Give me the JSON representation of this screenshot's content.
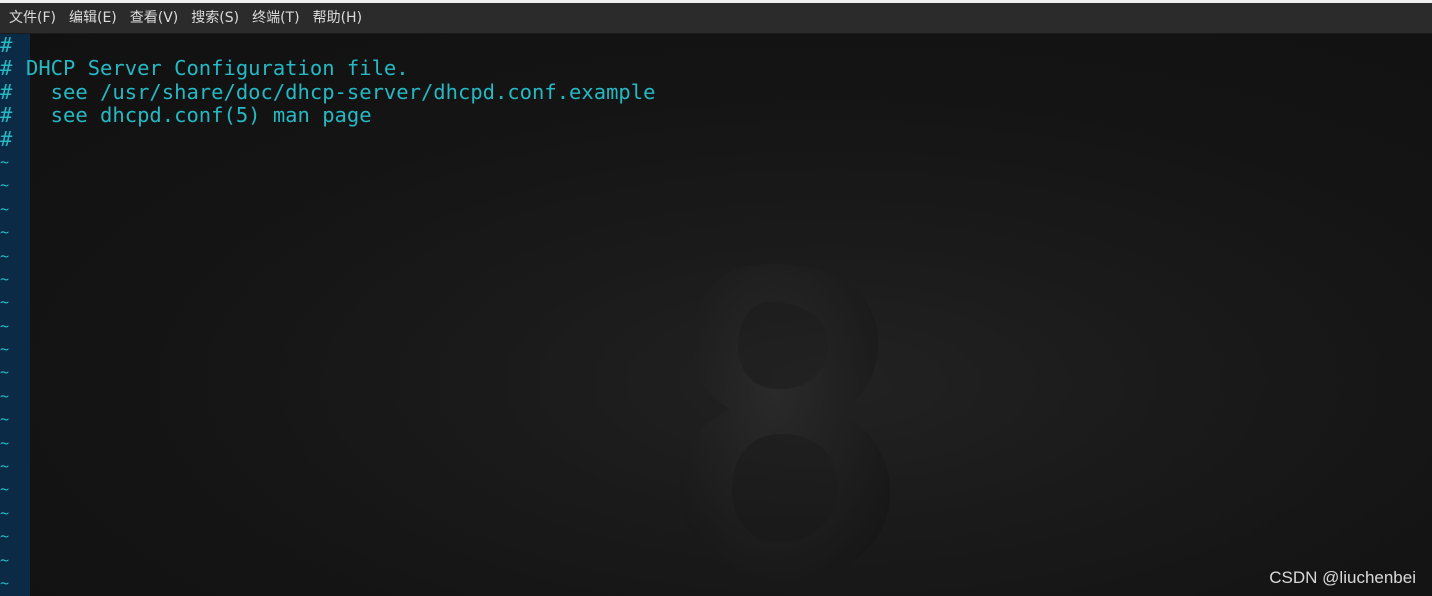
{
  "menu": {
    "items": [
      {
        "label": "文件(F)"
      },
      {
        "label": "编辑(E)"
      },
      {
        "label": "查看(V)"
      },
      {
        "label": "搜索(S)"
      },
      {
        "label": "终端(T)"
      },
      {
        "label": "帮助(H)"
      }
    ]
  },
  "editor": {
    "lines": [
      {
        "marker": "#",
        "text": ""
      },
      {
        "marker": "#",
        "text": "DHCP Server Configuration file."
      },
      {
        "marker": "#",
        "text": "  see /usr/share/doc/dhcp-server/dhcpd.conf.example"
      },
      {
        "marker": "#",
        "text": "  see dhcpd.conf(5) man page"
      },
      {
        "marker": "#",
        "text": ""
      }
    ],
    "empty_line_marker": "~",
    "empty_line_count": 19
  },
  "watermark": "CSDN @liuchenbei",
  "colors": {
    "menubar_bg": "#2b2b2b",
    "terminal_bg": "#141414",
    "text_cyan": "#25b9c4",
    "gutter_bg": "#0b2a45",
    "tilde": "#2a8fb2"
  }
}
